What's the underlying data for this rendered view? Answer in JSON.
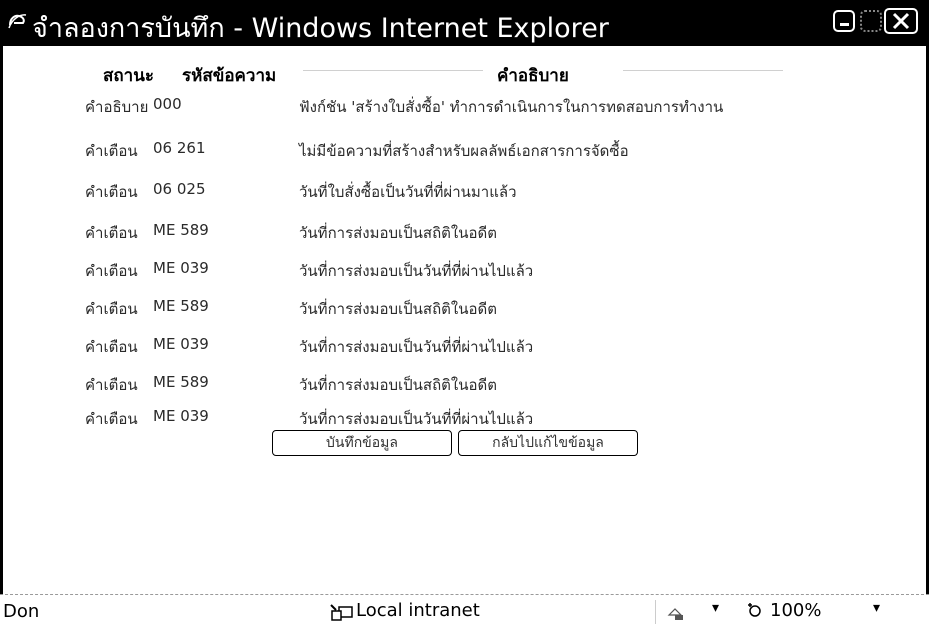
{
  "window": {
    "title": "จำลองการบันทึก - Windows Internet Explorer"
  },
  "table": {
    "headers": {
      "status": "สถานะ",
      "code": "รหัสข้อความ",
      "description": "คำอธิบาย"
    },
    "rows": [
      {
        "status": "คำอธิบาย",
        "code": "000",
        "description": "ฟังก์ชัน 'สร้างใบสั่งซื้อ' ทำการดำเนินการในการทดสอบการทำงาน"
      },
      {
        "status": "คำเตือน",
        "code": "06 261",
        "description": "ไม่มีข้อความที่สร้างสำหรับผลลัพธ์เอกสารการจัดซื้อ"
      },
      {
        "status": "คำเตือน",
        "code": "06 025",
        "description": "วันที่ใบสั่งซื้อเป็นวันที่ที่ผ่านมาแล้ว"
      },
      {
        "status": "คำเตือน",
        "code": "ME 589",
        "description": "วันที่การส่งมอบเป็นสถิติในอดีต"
      },
      {
        "status": "คำเตือน",
        "code": "ME 039",
        "description": "วันที่การส่งมอบเป็นวันที่ที่ผ่านไปแล้ว"
      },
      {
        "status": "คำเตือน",
        "code": "ME 589",
        "description": "วันที่การส่งมอบเป็นสถิติในอดีต"
      },
      {
        "status": "คำเตือน",
        "code": "ME 039",
        "description": "วันที่การส่งมอบเป็นวันที่ที่ผ่านไปแล้ว"
      },
      {
        "status": "คำเตือน",
        "code": "ME 589",
        "description": "วันที่การส่งมอบเป็นสถิติในอดีต"
      },
      {
        "status": "คำเตือน",
        "code": "ME 039",
        "description": "วันที่การส่งมอบเป็นวันที่ที่ผ่านไปแล้ว"
      }
    ]
  },
  "buttons": {
    "save": "บันทึกข้อมูล",
    "back": "กลับไปแก้ไขข้อมูล"
  },
  "statusbar": {
    "status": "Don",
    "zone": "Local intranet",
    "zoom": "100%"
  },
  "icons": {
    "title": "ie-logo-icon",
    "zone": "local-intranet-icon",
    "security": "protected-mode-icon",
    "zoom": "zoom-icon"
  }
}
